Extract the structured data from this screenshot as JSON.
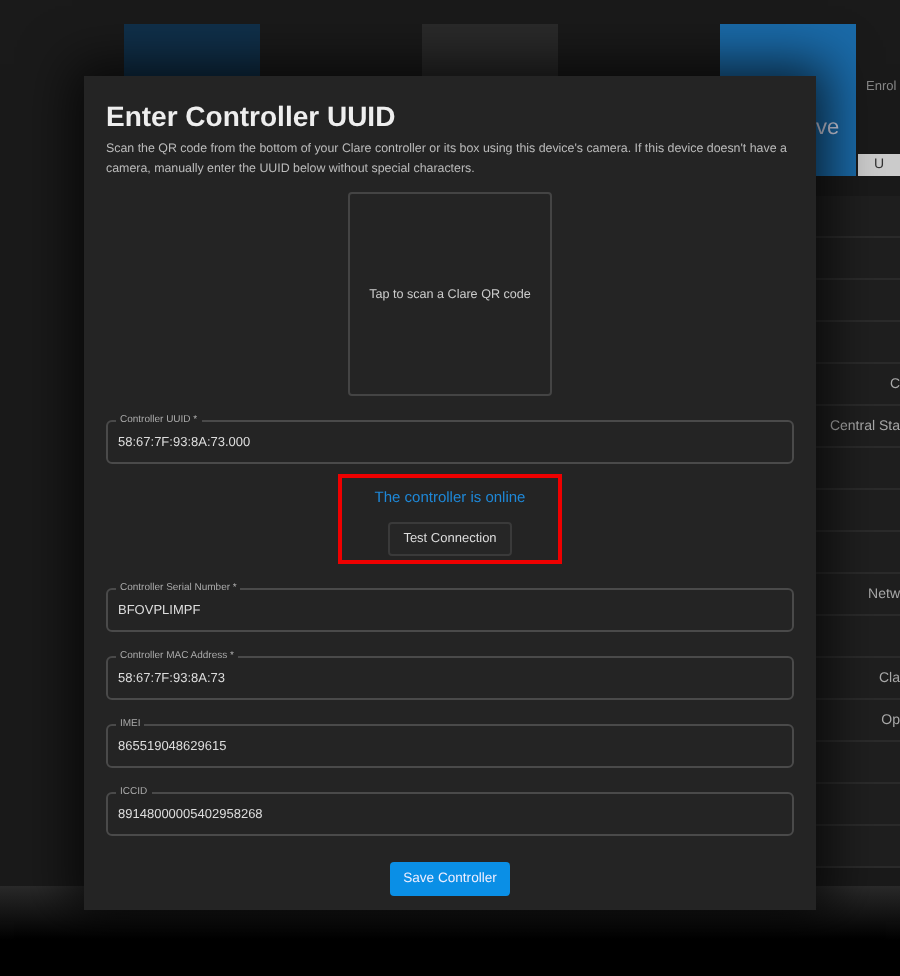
{
  "background": {
    "tiles": [
      {
        "kind": "dark-blue"
      },
      {
        "kind": "grey"
      },
      {
        "kind": "blue",
        "label": "ve"
      }
    ],
    "header_label": "Enrol",
    "tab_label": "U",
    "side_rows": [
      {
        "kind": "blank"
      },
      {
        "kind": "blank"
      },
      {
        "kind": "blank"
      },
      {
        "kind": "blank"
      },
      {
        "kind": "label",
        "label": "C"
      },
      {
        "kind": "label",
        "label": "Central Sta"
      },
      {
        "kind": "blank"
      },
      {
        "kind": "blank"
      },
      {
        "kind": "blank"
      },
      {
        "kind": "label",
        "label": "Netw"
      },
      {
        "kind": "blank"
      },
      {
        "kind": "label",
        "label": "Cla"
      },
      {
        "kind": "label",
        "label": "Op"
      },
      {
        "kind": "blank"
      },
      {
        "kind": "blank"
      },
      {
        "kind": "blank"
      }
    ]
  },
  "dialog": {
    "title": "Enter Controller UUID",
    "description": "Scan the QR code from the bottom of your Clare controller or its box using this device's camera. If this device doesn't have a camera, manually enter the UUID below without special characters.",
    "qr_prompt": "Tap to scan a Clare QR code",
    "fields": [
      {
        "label": "Controller UUID *",
        "value": "58:67:7F:93:8A:73.000"
      },
      {
        "label": "Controller Serial Number *",
        "value": "BFOVPLIMPF"
      },
      {
        "label": "Controller MAC Address *",
        "value": "58:67:7F:93:8A:73"
      },
      {
        "label": "IMEI",
        "value": "865519048629615"
      },
      {
        "label": "ICCID",
        "value": "89148000005402958268"
      }
    ],
    "status": "The controller is online",
    "test_button": "Test Connection",
    "highlighted": true,
    "save_button": "Save Controller"
  }
}
